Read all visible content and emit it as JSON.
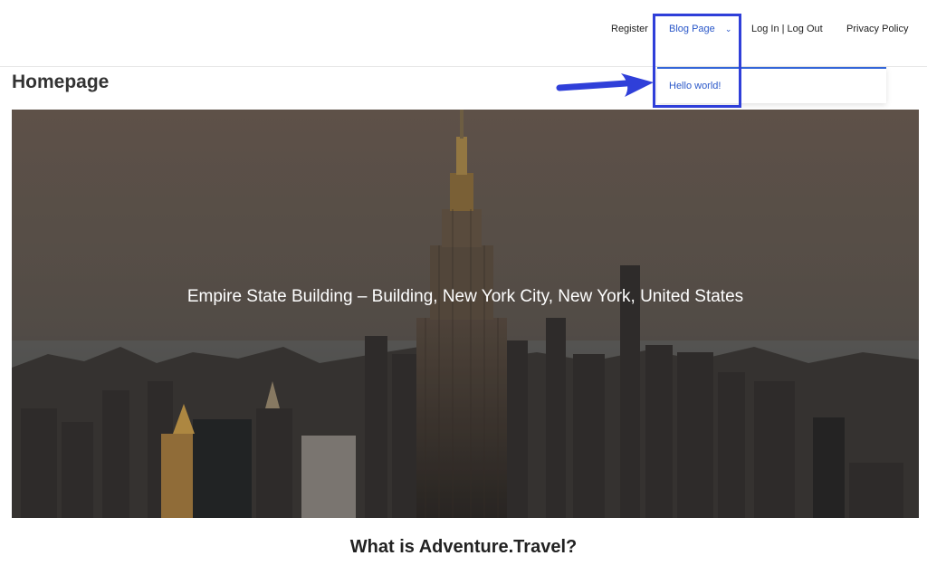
{
  "nav": {
    "register": "Register",
    "blog_page": "Blog Page",
    "login_logout": "Log In | Log Out",
    "privacy_policy": "Privacy Policy",
    "dropdown_items": [
      "Hello world!"
    ]
  },
  "page": {
    "title": "Homepage"
  },
  "hero": {
    "caption": "Empire State Building – Building, New York City, New York, United States"
  },
  "section": {
    "heading": "What is Adventure.Travel?"
  },
  "colors": {
    "link_blue": "#2b58c9",
    "annotation_blue": "#2f3fd9"
  },
  "icons": {
    "blog_dropdown": "chevron-down-icon",
    "annotation": "arrow-right-icon"
  }
}
